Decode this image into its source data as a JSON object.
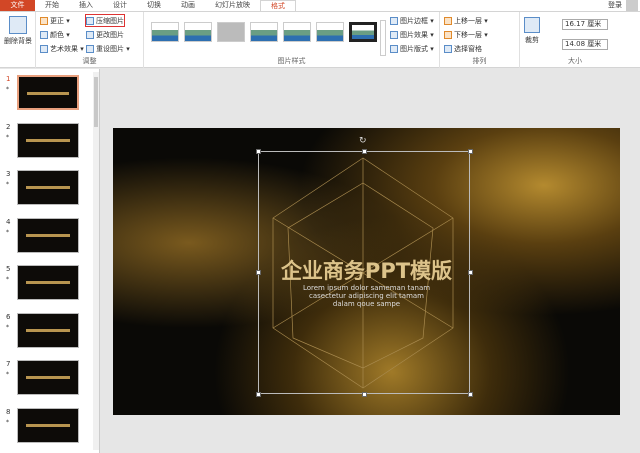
{
  "tabs": [
    "文件",
    "开始",
    "插入",
    "设计",
    "切换",
    "动画",
    "幻灯片放映",
    "格式"
  ],
  "active_tab": "格式",
  "login": "登录",
  "ribbon": {
    "remove_bg": "删除背景",
    "adjust": {
      "items": [
        "更正 ▾",
        "颜色 ▾",
        "艺术效果 ▾",
        "压缩图片",
        "更改图片",
        "重设图片 ▾"
      ],
      "label": "调整"
    },
    "styles_label": "图片样式",
    "style_right": [
      "图片边框 ▾",
      "图片效果 ▾",
      "图片版式 ▾"
    ],
    "arrange": {
      "items": [
        "上移一层 ▾",
        "下移一层 ▾",
        "选择窗格"
      ],
      "label": "排列"
    },
    "crop": "裁剪",
    "size": {
      "height": "16.17 厘米",
      "width": "14.08 厘米",
      "label": "大小"
    }
  },
  "slides": [
    {
      "num": "1"
    },
    {
      "num": "2"
    },
    {
      "num": "3"
    },
    {
      "num": "4"
    },
    {
      "num": "5"
    },
    {
      "num": "6"
    },
    {
      "num": "7"
    },
    {
      "num": "8"
    }
  ],
  "slide_star": "*",
  "main_slide": {
    "title": "企业商务PPT模版",
    "subtitle": [
      "Lorem ipsum dolor sameman tanam",
      "casectetur adipiscing elit tamam",
      "dalam qoue sampe"
    ]
  },
  "colors": {
    "accent": "#d24726",
    "highlight": "#dd3333"
  }
}
